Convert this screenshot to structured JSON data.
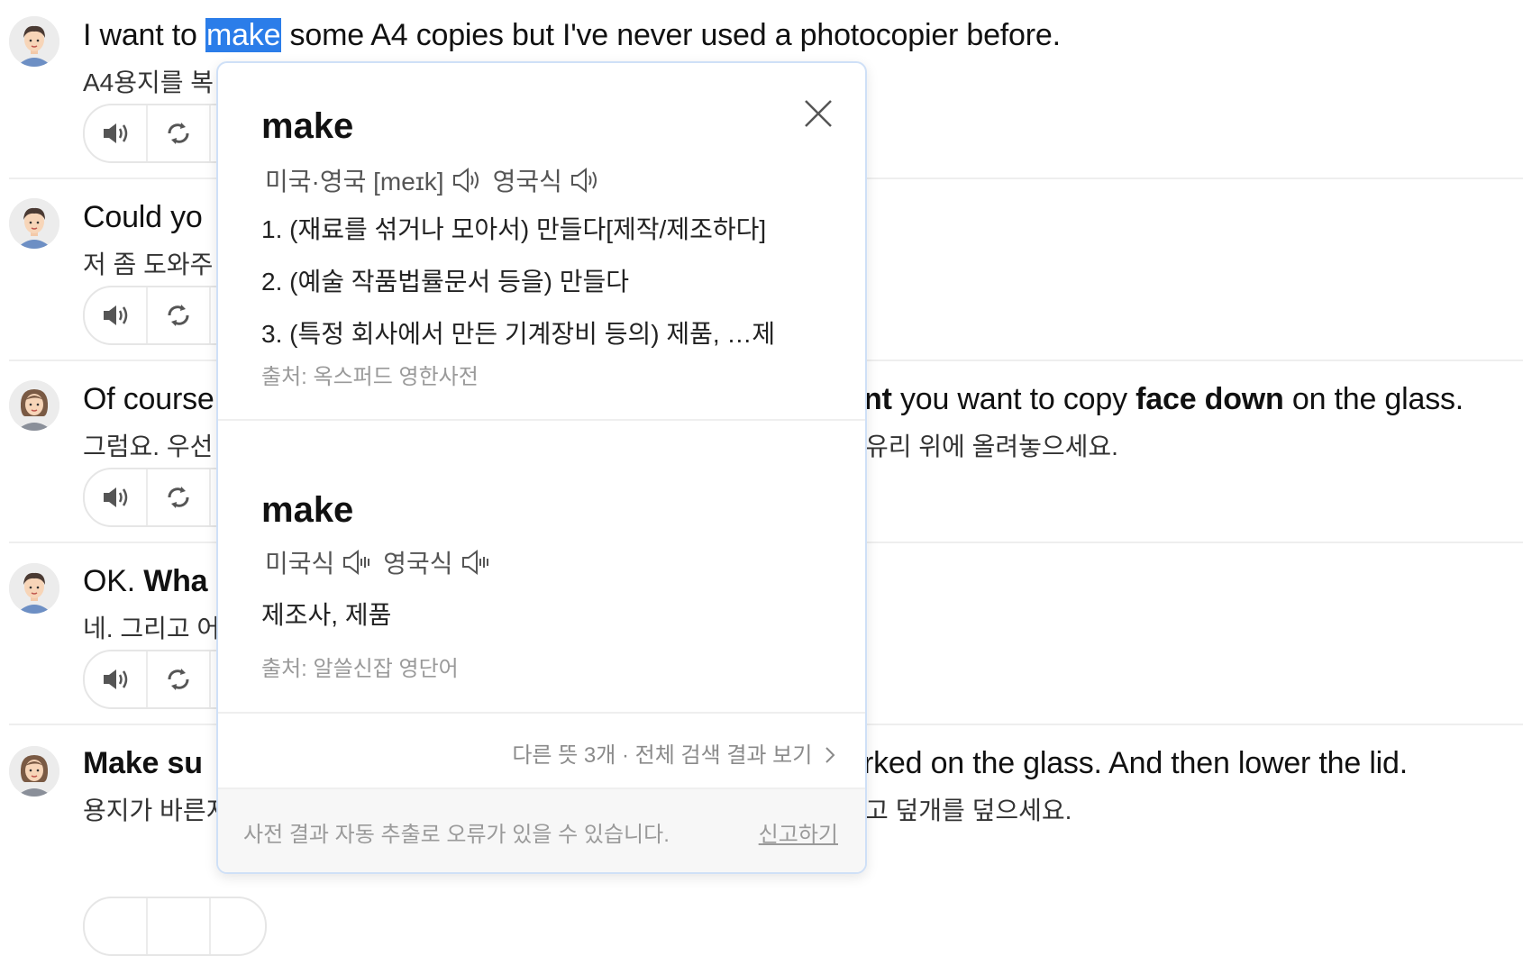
{
  "conversation": [
    {
      "speaker": "male",
      "en_parts": [
        {
          "t": "I want to "
        },
        {
          "t": "make",
          "hl": true
        },
        {
          "t": " some A4 copies but I've never used a photocopier before."
        }
      ],
      "ko": "A4용지를 복"
    },
    {
      "speaker": "male",
      "en_parts": [
        {
          "t": "Could yo"
        }
      ],
      "ko": "저 좀 도와주"
    },
    {
      "speaker": "female",
      "en_left": "Of course",
      "en_right_parts": [
        {
          "t": "nt",
          "b": true
        },
        {
          "t": " you want to copy "
        },
        {
          "t": "face down",
          "b": true
        },
        {
          "t": " on the glass."
        }
      ],
      "ko_left": "그럼요. 우선",
      "ko_right": "유리 위에 올려놓으세요."
    },
    {
      "speaker": "male",
      "en_parts": [
        {
          "t": "OK. "
        },
        {
          "t": "Wha",
          "b": true
        }
      ],
      "ko": "네. 그리고 어"
    },
    {
      "speaker": "female",
      "en_left_parts": [
        {
          "t": "Make su",
          "b": true
        }
      ],
      "en_right": "rked on the glass. And then lower the lid.",
      "ko_left": "용지가 바른지,",
      "ko_right": "고 덮개를 덮으세요."
    }
  ],
  "popup": {
    "entry1": {
      "word": "make",
      "pron_us_uk": "미국·영국 [meɪk]",
      "pron_uk": "영국식",
      "defs": [
        "1.  (재료를 섞거나 모아서) 만들다[제작/제조하다]",
        "2.  (예술 작품법률문서 등을) 만들다",
        "3.  (특정 회사에서 만든 기계장비 등의) 제품, …제"
      ],
      "source": "출처: 옥스퍼드 영한사전"
    },
    "entry2": {
      "word": "make",
      "pron_us": "미국식",
      "pron_uk": "영국식",
      "def": "제조사, 제품",
      "source": "출처: 알쓸신잡 영단어"
    },
    "more": "다른 뜻 3개 · 전체 검색 결과 보기",
    "note": "사전 결과 자동 추출로 오류가 있을 수 있습니다.",
    "report": "신고하기"
  },
  "icons": {
    "speaker": "speaker-icon",
    "repeat": "repeat-icon",
    "close": "close-icon",
    "chevron": "chevron-right-icon"
  },
  "colors": {
    "highlight": "#2b7de9",
    "popup_border": "#cfe0f7"
  }
}
